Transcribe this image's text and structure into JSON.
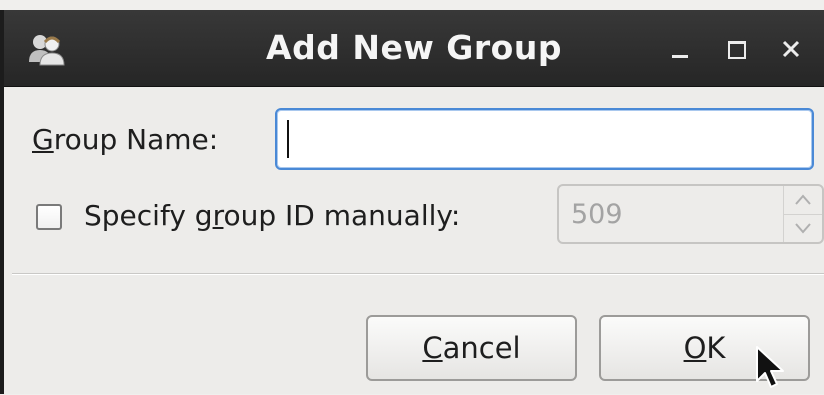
{
  "window": {
    "title": "Add New Group",
    "icon": "users-icon",
    "controls": {
      "minimize": "minimize-icon",
      "maximize": "maximize-icon",
      "close": "close-icon"
    }
  },
  "form": {
    "group_name_label_mnemonic": "G",
    "group_name_label_rest": "roup Name:",
    "group_name_value": "",
    "specify_label_part1": "Specify g",
    "specify_label_mnemonic": "r",
    "specify_label_part2": "oup ID manually:",
    "specify_checked": false,
    "group_id_value": "509",
    "group_id_enabled": false
  },
  "buttons": {
    "cancel_mnemonic": "C",
    "cancel_rest": "ancel",
    "ok_mnemonic": "O",
    "ok_rest": "K"
  },
  "colors": {
    "titlebar": "#2e2e2e",
    "focus_border": "#4a89d6",
    "dialog_bg": "#edecea"
  }
}
